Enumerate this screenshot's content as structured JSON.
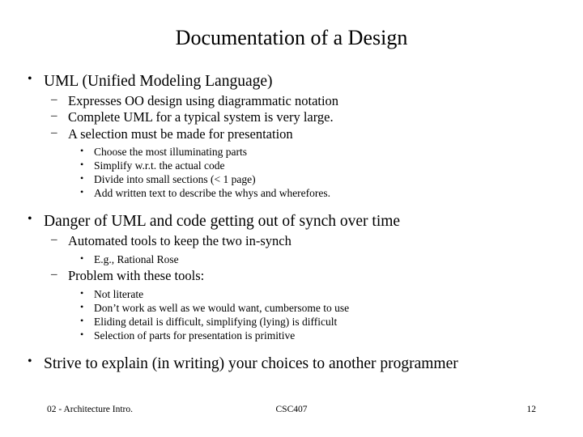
{
  "slide": {
    "title": "Documentation of a Design",
    "blocks": [
      {
        "level1": "UML (Unified Modeling Language)",
        "level2": [
          {
            "text": "Expresses OO design using diagrammatic notation",
            "level3": []
          },
          {
            "text": "Complete UML for a typical system is very large.",
            "level3": []
          },
          {
            "text": "A selection must be made for presentation",
            "level3": [
              "Choose the most illuminating parts",
              "Simplify w.r.t. the actual code",
              "Divide into small sections (< 1 page)",
              "Add written text to describe the whys and wherefores."
            ]
          }
        ]
      },
      {
        "level1": "Danger of UML and code getting out of synch over time",
        "level2": [
          {
            "text": "Automated tools to keep the two in-synch",
            "level3": [
              "E.g., Rational Rose"
            ]
          },
          {
            "text": "Problem with these tools:",
            "level3": [
              "Not literate",
              "Don’t work as well as we would want, cumbersome to use",
              "Eliding detail is difficult, simplifying (lying) is difficult",
              "Selection of parts for presentation is primitive"
            ]
          }
        ]
      },
      {
        "level1": "Strive to explain (in writing) your choices to another programmer",
        "level2": []
      }
    ],
    "bullets": {
      "level1_marker": "•",
      "level2_marker": "–",
      "level3_marker": "•"
    }
  },
  "footer": {
    "left": "02 - Architecture Intro.",
    "center": "CSC407",
    "right": "12"
  }
}
